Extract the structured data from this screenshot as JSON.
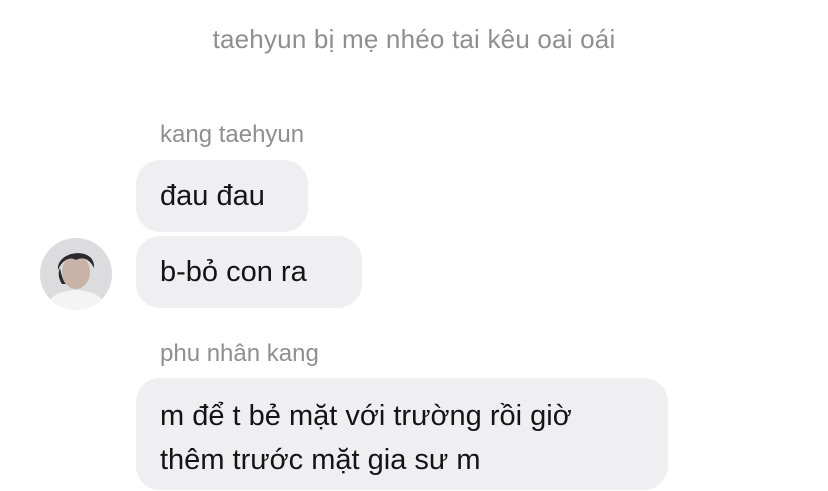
{
  "system_message": "taehyun bị mẹ nhéo tai kêu oai oái",
  "groups": [
    {
      "sender": "kang taehyun",
      "messages": [
        "đau đau",
        "b-bỏ con ra"
      ]
    },
    {
      "sender": "phu nhân kang",
      "messages": [
        "m để t bẻ mặt với trường rồi giờ",
        "thêm trước mặt gia sư m"
      ]
    }
  ],
  "icons": {
    "avatar": "user-avatar-photo"
  }
}
